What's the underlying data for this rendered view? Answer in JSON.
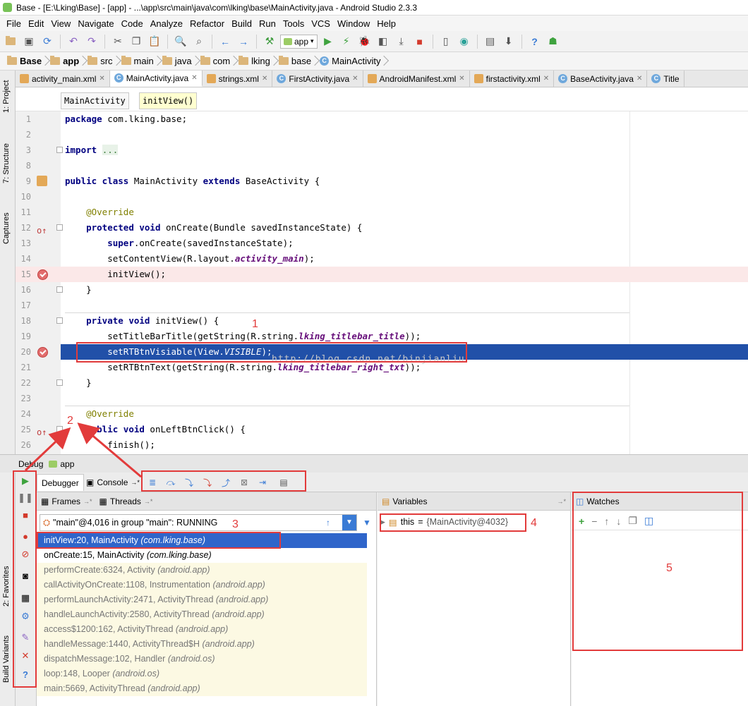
{
  "window": {
    "title": "Base - [E:\\Lking\\Base] - [app] - ...\\app\\src\\main\\java\\com\\lking\\base\\MainActivity.java - Android Studio 2.3.3"
  },
  "menu": {
    "items": [
      "File",
      "Edit",
      "View",
      "Navigate",
      "Code",
      "Analyze",
      "Refactor",
      "Build",
      "Run",
      "Tools",
      "VCS",
      "Window",
      "Help"
    ]
  },
  "toolbar": {
    "run_config": "app"
  },
  "breadcrumb": {
    "items": [
      "Base",
      "app",
      "src",
      "main",
      "java",
      "com",
      "lking",
      "base",
      "MainActivity"
    ]
  },
  "editor_tabs": [
    {
      "label": "activity_main.xml",
      "active": false
    },
    {
      "label": "MainActivity.java",
      "active": true
    },
    {
      "label": "strings.xml",
      "active": false
    },
    {
      "label": "FirstActivity.java",
      "active": false
    },
    {
      "label": "AndroidManifest.xml",
      "active": false
    },
    {
      "label": "firstactivity.xml",
      "active": false
    },
    {
      "label": "BaseActivity.java",
      "active": false
    },
    {
      "label": "Title",
      "active": false
    }
  ],
  "left_tool_windows": [
    "1: Project",
    "7: Structure",
    "Captures",
    "2: Favorites",
    "Build Variants"
  ],
  "editor_breadcrumb": {
    "class": "MainActivity",
    "method": "initView()"
  },
  "code": {
    "line_numbers": [
      "1",
      "2",
      "3",
      "8",
      "9",
      "10",
      "11",
      "12",
      "13",
      "14",
      "15",
      "16",
      "17",
      "18",
      "19",
      "20",
      "21",
      "22",
      "23",
      "24",
      "25",
      "26"
    ],
    "package_kw": "package",
    "package_name": " com.lking.base;",
    "import_kw": "import",
    "import_fold": "...",
    "class_kw1": "public class",
    "class_name": " MainActivity ",
    "class_kw2": "extends",
    "class_rest": " BaseActivity {",
    "override": "@Override",
    "oncreate_kw": "protected void",
    "oncreate_rest": " onCreate(Bundle savedInstanceState) {",
    "super_kw": "super",
    "super_rest": ".onCreate(savedInstanceState);",
    "setcontent_pre": "setContentView(R.layout.",
    "setcontent_field": "activity_main",
    "setcontent_post": ");",
    "initview_call": "initView();",
    "close_brace": "}",
    "initview_kw": "private void",
    "initview_rest": " initView() {",
    "settitle_pre": "setTitleBarTitle(getString(R.string.",
    "settitle_field": "lking_titlebar_title",
    "settitle_post": "));",
    "setrtbtn_pre": "setRTBtnVisiable(View.",
    "setrtbtn_field": "VISIBLE",
    "setrtbtn_post": ");",
    "setrttext_pre": "setRTBtnText(getString(R.string.",
    "setrttext_field": "lking_titlebar_right_txt",
    "setrttext_post": "));",
    "onleft_kw": "public void",
    "onleft_rest": " onLeftBtnClick() {",
    "finish_call": "finish();"
  },
  "watermark": "http://blog.csdn.net/binjianliu",
  "debug": {
    "header_label": "Debug",
    "header_config": "app",
    "tabs": [
      "Debugger",
      "Console"
    ],
    "frames_title": "Frames",
    "threads_title": "Threads",
    "thread_selector": "\"main\"@4,016 in group \"main\": RUNNING",
    "frames": [
      {
        "method": "initView:20, MainActivity ",
        "pkg": "(com.lking.base)"
      },
      {
        "method": "onCreate:15, MainActivity ",
        "pkg": "(com.lking.base)"
      },
      {
        "method": "performCreate:6324, Activity ",
        "pkg": "(android.app)"
      },
      {
        "method": "callActivityOnCreate:1108, Instrumentation ",
        "pkg": "(android.app)"
      },
      {
        "method": "performLaunchActivity:2471, ActivityThread ",
        "pkg": "(android.app)"
      },
      {
        "method": "handleLaunchActivity:2580, ActivityThread ",
        "pkg": "(android.app)"
      },
      {
        "method": "access$1200:162, ActivityThread ",
        "pkg": "(android.app)"
      },
      {
        "method": "handleMessage:1440, ActivityThread$H ",
        "pkg": "(android.app)"
      },
      {
        "method": "dispatchMessage:102, Handler ",
        "pkg": "(android.os)"
      },
      {
        "method": "loop:148, Looper ",
        "pkg": "(android.os)"
      },
      {
        "method": "main:5669, ActivityThread ",
        "pkg": "(android.app)"
      }
    ],
    "variables_title": "Variables",
    "variable": {
      "name": "this",
      "eq": " = ",
      "value": "{MainActivity@4032}"
    },
    "watches_title": "Watches"
  },
  "annotations": [
    "1",
    "2",
    "3",
    "4",
    "5"
  ],
  "colors": {
    "selection": "#2f65ca",
    "breakpoint_line": "#fbe8e8",
    "annotation": "#e23b3b"
  }
}
